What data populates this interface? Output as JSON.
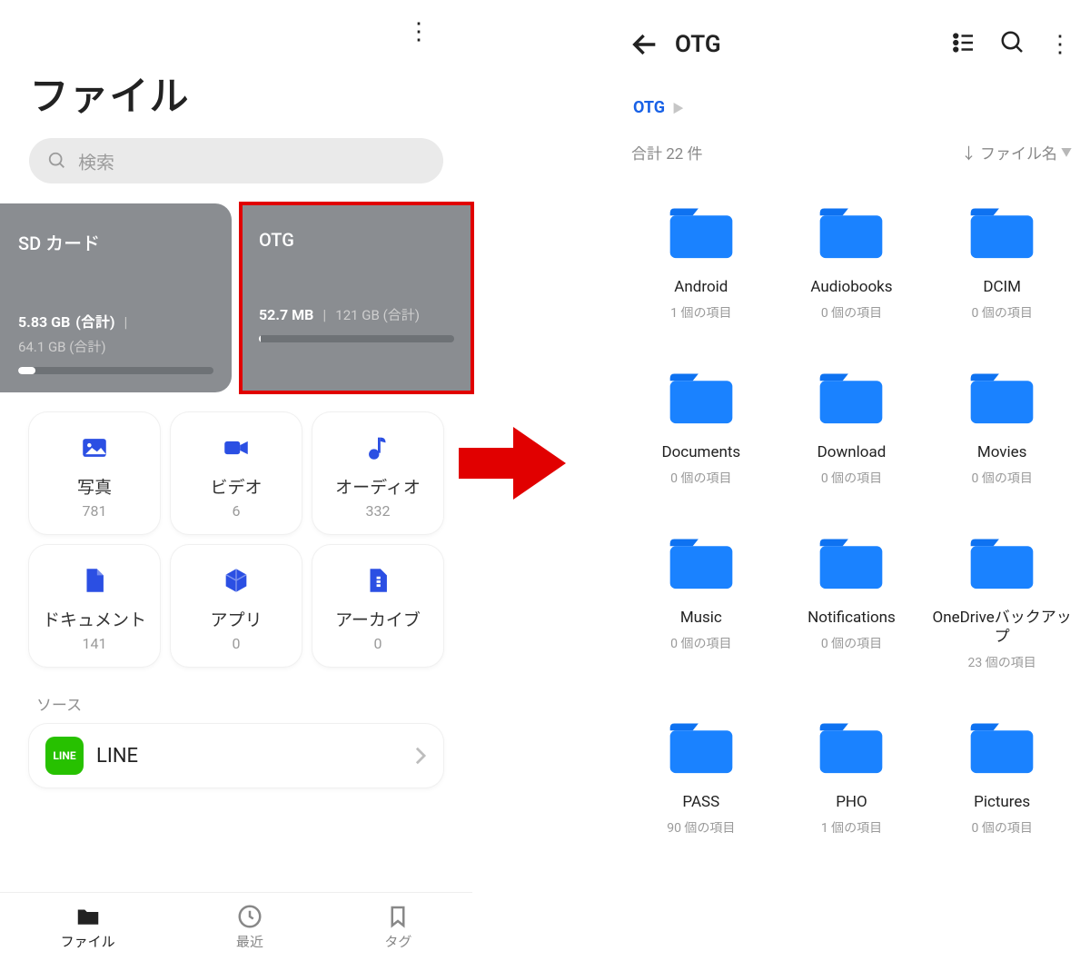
{
  "left": {
    "page_title": "ファイル",
    "search_placeholder": "検索",
    "storage": [
      {
        "title": "SD カード",
        "used": "5.83 GB",
        "used_label": "(合計)",
        "total": "64.1 GB (合計)",
        "progress_pct": 9
      },
      {
        "title": "OTG",
        "used": "52.7 MB",
        "used_label": "",
        "total": "121 GB (合計)",
        "progress_pct": 1
      }
    ],
    "categories": [
      {
        "label": "写真",
        "count": "781"
      },
      {
        "label": "ビデオ",
        "count": "6"
      },
      {
        "label": "オーディオ",
        "count": "332"
      },
      {
        "label": "ドキュメント",
        "count": "141"
      },
      {
        "label": "アプリ",
        "count": "0"
      },
      {
        "label": "アーカイブ",
        "count": "0"
      }
    ],
    "section_sources": "ソース",
    "source_name": "LINE",
    "nav": {
      "file": "ファイル",
      "recent": "最近",
      "tag": "タグ"
    }
  },
  "right": {
    "title": "OTG",
    "breadcrumb": "OTG",
    "total_label": "合計 22 件",
    "sort_label": "ファイル名",
    "folders": [
      {
        "name": "Android",
        "sub": "1 個の項目"
      },
      {
        "name": "Audiobooks",
        "sub": "0 個の項目"
      },
      {
        "name": "DCIM",
        "sub": "0 個の項目"
      },
      {
        "name": "Documents",
        "sub": "0 個の項目"
      },
      {
        "name": "Download",
        "sub": "0 個の項目"
      },
      {
        "name": "Movies",
        "sub": "0 個の項目"
      },
      {
        "name": "Music",
        "sub": "0 個の項目"
      },
      {
        "name": "Notifications",
        "sub": "0 個の項目"
      },
      {
        "name": "OneDriveバックアップ",
        "sub": "23 個の項目"
      },
      {
        "name": "PASS",
        "sub": "90 個の項目"
      },
      {
        "name": "PHO",
        "sub": "1 個の項目"
      },
      {
        "name": "Pictures",
        "sub": "0 個の項目"
      }
    ]
  }
}
